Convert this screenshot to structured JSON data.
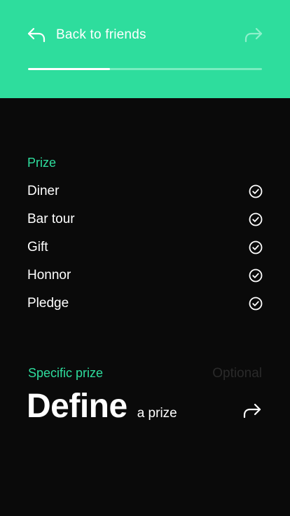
{
  "header": {
    "back_label": "Back to friends",
    "progress": 0.35,
    "accent_color": "#2edd9d"
  },
  "prize_section": {
    "label": "Prize",
    "items": [
      {
        "label": "Diner",
        "icon": "check-circle-icon"
      },
      {
        "label": "Bar tour",
        "icon": "check-circle-icon"
      },
      {
        "label": "Gift",
        "icon": "check-circle-icon"
      },
      {
        "label": "Honnor",
        "icon": "check-circle-icon"
      },
      {
        "label": "Pledge",
        "icon": "check-circle-icon"
      }
    ]
  },
  "specific_prize": {
    "label": "Specific prize",
    "optional_label": "Optional",
    "define_big": "Define",
    "define_small": "a prize"
  }
}
